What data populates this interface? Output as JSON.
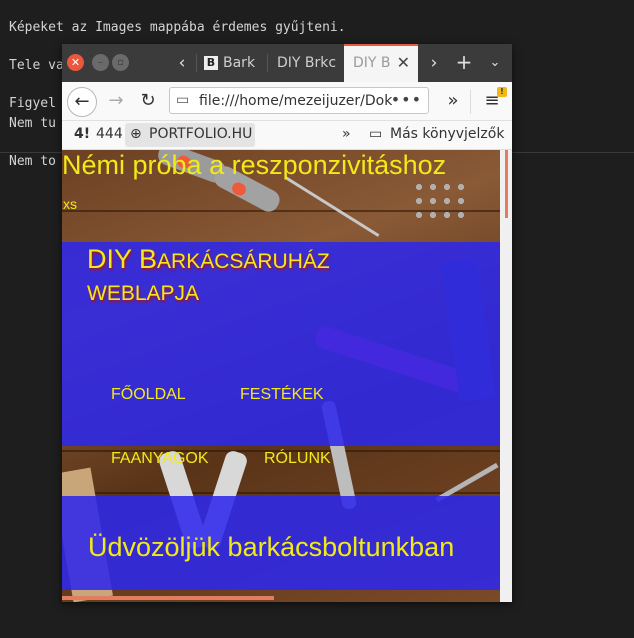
{
  "terminal": {
    "lines": [
      "Képeket az Images mappába érdemes gyűjteni.",
      "Tele va",
      "Figyel",
      "Nem tu",
      "Nem to"
    ]
  },
  "browser": {
    "tabs": [
      {
        "label": "Bark",
        "favicon": "B"
      },
      {
        "label": "DIY Brkc"
      },
      {
        "label": "DIY B"
      }
    ],
    "url": "file:///home/mezeijuzer/Dok",
    "bookmarks": {
      "item1": "444",
      "item2": "PORTFOLIO.HU",
      "other": "Más könyvjelzők"
    }
  },
  "page": {
    "heading": "Némi próba a reszponzivitáshoz",
    "size_tag": "xs",
    "brand_line1_a": "DIY B",
    "brand_line1_b": "ARKÁCSÁRUHÁZ",
    "brand_line2": "WEBLAPJA",
    "menu": [
      "FŐOLDAL",
      "FESTÉKEK",
      "FAANYAGOK",
      "RÓLUNK"
    ],
    "welcome": "Üdvözöljük barkácsboltunkban"
  },
  "colors": {
    "accent_text": "#f2ea18",
    "band": "#2e28eb",
    "tab_accent": "#e95a42"
  }
}
